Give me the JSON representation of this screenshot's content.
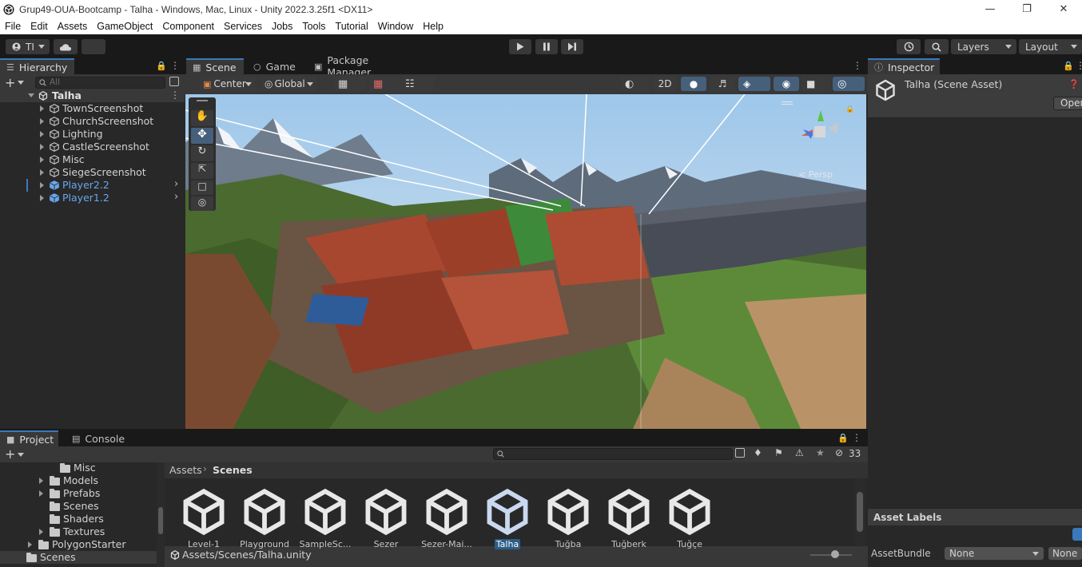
{
  "window": {
    "title": "Grup49-OUA-Bootcamp - Talha - Windows, Mac, Linux - Unity 2022.3.25f1 <DX11>"
  },
  "menu": [
    "File",
    "Edit",
    "Assets",
    "GameObject",
    "Component",
    "Services",
    "Jobs",
    "Tools",
    "Tutorial",
    "Window",
    "Help"
  ],
  "toolbar": {
    "account_label": "TI",
    "layers_label": "Layers",
    "layout_label": "Layout"
  },
  "hierarchy": {
    "tab_label": "Hierarchy",
    "search_placeholder": "All",
    "scene_name": "Talha",
    "items": [
      {
        "label": "TownScreenshot",
        "prefab": false
      },
      {
        "label": "ChurchScreenshot",
        "prefab": false
      },
      {
        "label": "Lighting",
        "prefab": false
      },
      {
        "label": "CastleScreenshot",
        "prefab": false
      },
      {
        "label": "Misc",
        "prefab": false
      },
      {
        "label": "SiegeScreenshot",
        "prefab": false
      },
      {
        "label": "Player2.2",
        "prefab": true
      },
      {
        "label": "Player1.2",
        "prefab": true
      }
    ]
  },
  "scene_tabs": {
    "scene": "Scene",
    "game": "Game",
    "package_manager": "Package Manager"
  },
  "scene_toolbar": {
    "pivot": "Center",
    "space": "Global",
    "mode_2d": "2D"
  },
  "scene_view": {
    "persp_label": "< Persp"
  },
  "inspector": {
    "tab_label": "Inspector",
    "asset_title": "Talha (Scene Asset)",
    "open_button": "Open",
    "asset_labels_header": "Asset Labels",
    "assetbundle_label": "AssetBundle",
    "assetbundle_value": "None",
    "assetbundle_variant": "None"
  },
  "project": {
    "tab_project": "Project",
    "tab_console": "Console",
    "hidden_count": "33",
    "breadcrumb_root": "Assets",
    "breadcrumb_current": "Scenes",
    "footer_path": "Assets/Scenes/Talha.unity",
    "tree": [
      {
        "label": "Misc",
        "expandable": false
      },
      {
        "label": "Models",
        "expandable": true
      },
      {
        "label": "Prefabs",
        "expandable": true
      },
      {
        "label": "Scenes",
        "expandable": false
      },
      {
        "label": "Shaders",
        "expandable": false
      },
      {
        "label": "Textures",
        "expandable": true
      },
      {
        "label": "PolygonStarter",
        "expandable": true
      },
      {
        "label": "Scenes",
        "expandable": false
      }
    ],
    "assets": [
      {
        "label": "Level-1",
        "selected": false
      },
      {
        "label": "Playground",
        "selected": false
      },
      {
        "label": "SampleSc...",
        "selected": false
      },
      {
        "label": "Sezer",
        "selected": false
      },
      {
        "label": "Sezer-Mai...",
        "selected": false
      },
      {
        "label": "Talha",
        "selected": true
      },
      {
        "label": "Tuğba",
        "selected": false
      },
      {
        "label": "Tuğberk",
        "selected": false
      },
      {
        "label": "Tuğçe",
        "selected": false
      }
    ]
  },
  "colors": {
    "accent": "#3a79bb",
    "prefab_blue": "#67a7ee",
    "selection": "#2c5d87"
  }
}
